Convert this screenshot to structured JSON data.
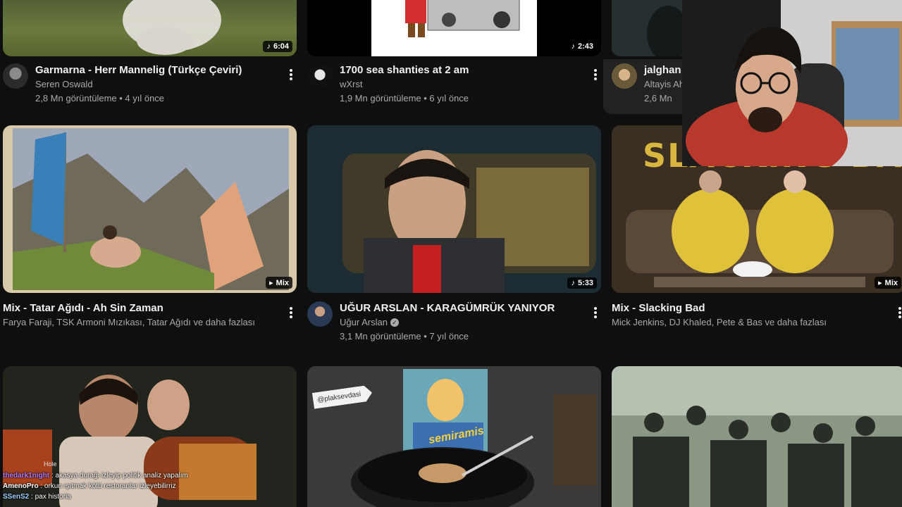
{
  "row1": [
    {
      "title": "Garmarna - Herr Mannelig (Türkçe Çeviri)",
      "channel": "Seren Oswald",
      "stats": "2,8 Mn görüntüleme • 4 yıl önce",
      "duration": "6:04"
    },
    {
      "title": "1700 sea shanties at 2 am",
      "channel": "wXrst",
      "stats": "1,9 Mn görüntüleme • 6 yıl önce",
      "duration": "2:43"
    },
    {
      "title": "jalghan a",
      "channel": "Altayis Ah",
      "stats": "2,6 Mn"
    }
  ],
  "row2": [
    {
      "title": "Mix - Tatar Ağıdı - Ah Sin Zaman",
      "channel": "Farya Faraji, TSK Armoni Mızıkası, Tatar Ağıdı ve daha fazlası",
      "badge": "Mix"
    },
    {
      "title": "UĞUR ARSLAN - KARAGÜMRÜK YANIYOR",
      "channel": "Uğur Arslan",
      "stats": "3,1 Mn görüntüleme • 7 yıl önce",
      "duration": "5:33"
    },
    {
      "title": "Mix - Slacking Bad",
      "channel": "Mick Jenkins, DJ Khaled, Pete & Bas ve daha fazlası",
      "badge": "Mix",
      "thumb_text": "SLACKING BAD"
    }
  ],
  "row3": [
    {
      "overlay": "Hole"
    },
    {
      "sticker": "@plaksevdasi",
      "record_label": "semiramis"
    },
    {}
  ],
  "chat": [
    {
      "user": "thedark1night",
      "text": " : akasya durağı izleyip politik analiz yapalım",
      "color": "#b07cff"
    },
    {
      "user": "AmenoPro",
      "text": " : orkun ışıtmak kötü restoranlar izleyebilirriz",
      "color": "#ffffff"
    },
    {
      "user": "SSenS2",
      "text": " : pax historia",
      "color": "#9ad0ff"
    }
  ],
  "icons": {
    "music": "music-note-icon",
    "mix": "mix-playlist-icon",
    "verified": "verified-check-icon",
    "more": "more-vert-icon"
  }
}
